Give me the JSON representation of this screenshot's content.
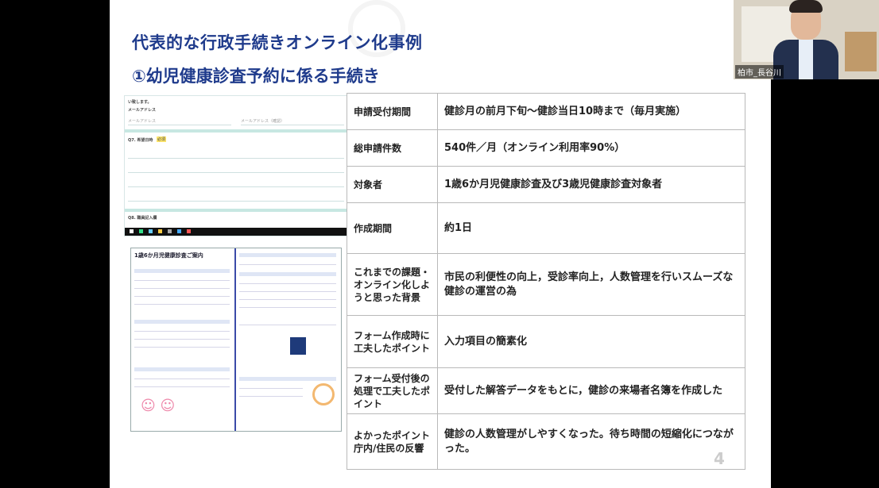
{
  "slide": {
    "title": "代表的な行政手続きオンライン化事例",
    "subtitle": "①幼児健康診査予約に係る手続き",
    "page_number": "4",
    "table": [
      {
        "label": "申請受付期間",
        "value": "健診月の前月下旬～健診当日10時まで（毎月実施）"
      },
      {
        "label": "総申請件数",
        "value": "540件／月（オンライン利用率90%）"
      },
      {
        "label": "対象者",
        "value": "1歳6か月児健康診査及び3歳児健康診査対象者"
      },
      {
        "label": "作成期間",
        "value": "約1日"
      },
      {
        "label": "これまでの課題・オンライン化しようと思った背景",
        "value": "市民の利便性の向上，受診率向上，人数管理を行いスムーズな健診の運営の為"
      },
      {
        "label": "フォーム作成時に工夫したポイント",
        "value": "入力項目の簡素化"
      },
      {
        "label": "フォーム受付後の処理で工夫したポイント",
        "value": "受付した解答データをもとに，健診の来場者名簿を作成した"
      },
      {
        "label": "よかったポイント庁内/住民の反響",
        "value": "健診の人数管理がしやすくなった。待ち時間の短縮化につながった。"
      }
    ],
    "form_screenshot": {
      "header_text": "い致します。",
      "email_label": "メールアドレス",
      "email_placeholder": "メールアドレス",
      "email_confirm_placeholder": "メールアドレス（確認）",
      "q7_label": "Q7. 希望日時",
      "q7_badge": "必須",
      "q8_label": "Q8. 職員記入欄"
    },
    "flyer": {
      "title": "1歳6か月児健康診査ご案内"
    }
  },
  "webcam": {
    "name": "柏市_長谷川"
  }
}
